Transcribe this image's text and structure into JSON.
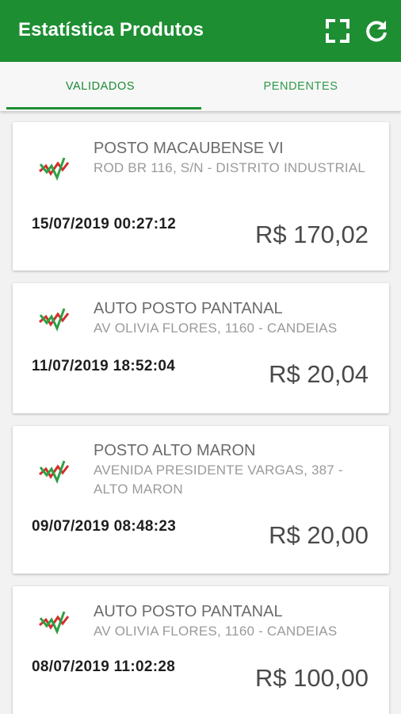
{
  "header": {
    "title": "Estatística Produtos",
    "actions": [
      "fullscreen-icon",
      "refresh-icon"
    ]
  },
  "colors": {
    "primary": "#1e8e33",
    "tab_text": "#2e9a49",
    "logo_red": "#d32f2f",
    "logo_green": "#2ea043"
  },
  "tabs": [
    {
      "label": "VALIDADOS",
      "active": true
    },
    {
      "label": "PENDENTES",
      "active": false
    }
  ],
  "items": [
    {
      "name": "POSTO MACAUBENSE VI",
      "address": "ROD BR 116, S/N - DISTRITO INDUSTRIAL",
      "date": "15/07/2019 00:27:12",
      "price": "R$ 170,02"
    },
    {
      "name": "AUTO POSTO PANTANAL",
      "address": "AV OLIVIA FLORES, 1160 - CANDEIAS",
      "date": "11/07/2019 18:52:04",
      "price": "R$ 20,04"
    },
    {
      "name": "POSTO ALTO MARON",
      "address": "AVENIDA PRESIDENTE VARGAS, 387 - ALTO MARON",
      "date": "09/07/2019 08:48:23",
      "price": "R$ 20,00"
    },
    {
      "name": "AUTO POSTO PANTANAL",
      "address": "AV OLIVIA FLORES, 1160 - CANDEIAS",
      "date": "08/07/2019 11:02:28",
      "price": "R$ 100,00"
    }
  ]
}
